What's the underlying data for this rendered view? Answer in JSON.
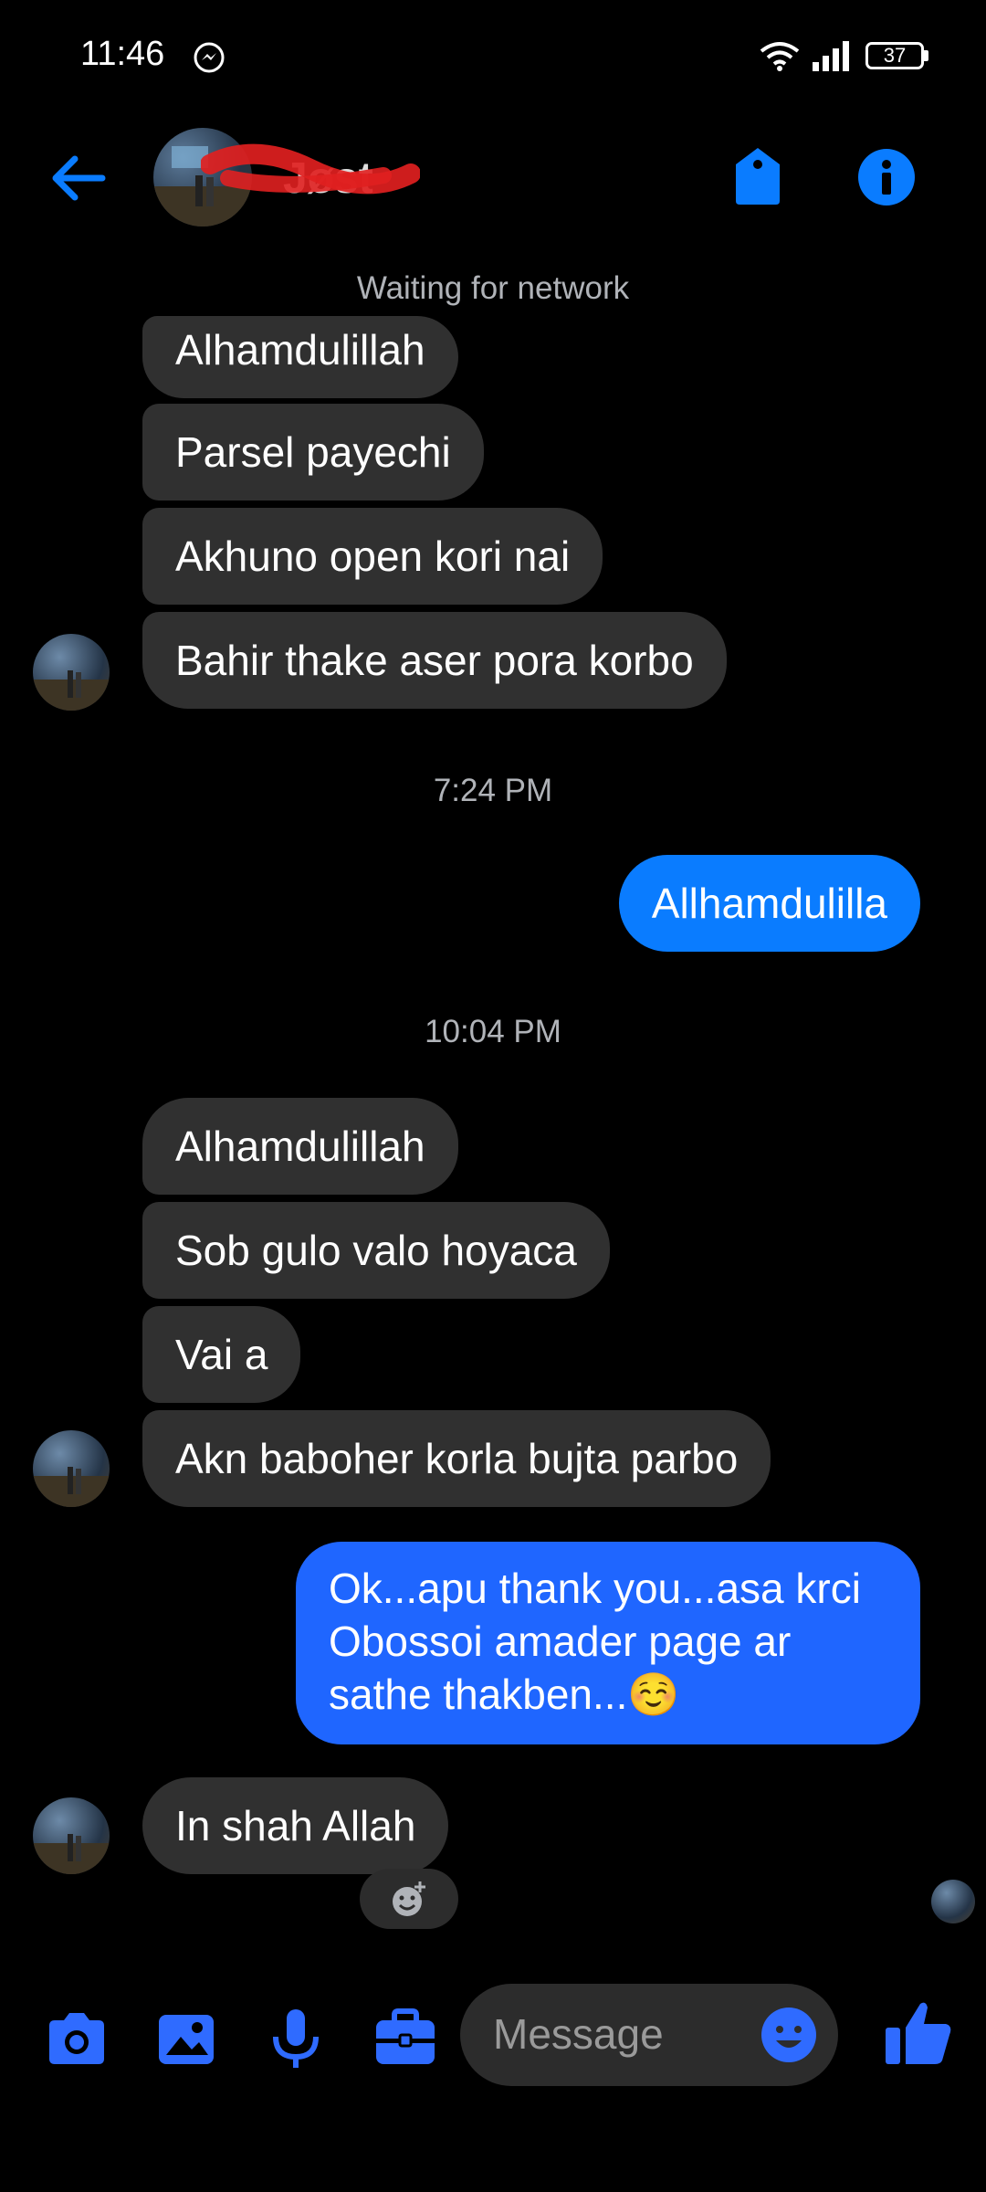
{
  "status_bar": {
    "time": "11:46",
    "battery": "37"
  },
  "header": {
    "contact_name": "Jøst"
  },
  "network_status": "Waiting for network",
  "messages_block1": [
    "Alhamdulillah",
    "Parsel payechi",
    "Akhuno open kori nai",
    "Bahir thake aser pora korbo"
  ],
  "time1": "7:24 PM",
  "out1": "Allhamdulilla",
  "time2": "10:04 PM",
  "messages_block2": [
    "Alhamdulillah",
    "Sob gulo valo hoyaca",
    "Vai a",
    "Akn baboher korla bujta parbo"
  ],
  "out2": "Ok...apu thank you...asa krci Obossoi amader page ar sathe thakben...☺️",
  "last_in": "In shah Allah",
  "composer": {
    "placeholder": "Message"
  },
  "colors": {
    "accent": "#0a7cff",
    "incoming_bubble": "#303030",
    "background": "#000000"
  }
}
